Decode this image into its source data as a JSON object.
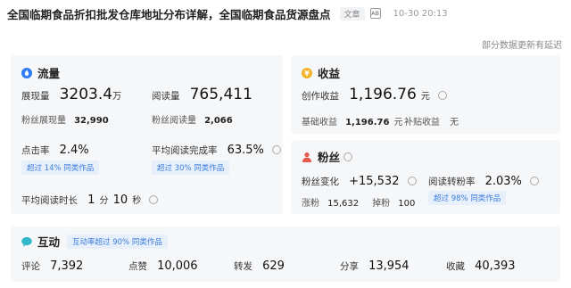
{
  "header": {
    "title": "全国临期食品折扣批发仓库地址分布详解，全国临期食品货源盘点",
    "tag": "文章",
    "ai_icon_text": "AB",
    "date": "10-30 20:13"
  },
  "update_note": "部分数据更新有延迟",
  "flow": {
    "title": "流量",
    "views_label": "展现量",
    "views_value": "3203.4",
    "views_unit": "万",
    "reads_label": "阅读量",
    "reads_value": "765,411",
    "fan_views_label": "粉丝展现量",
    "fan_views_value": "32,990",
    "fan_reads_label": "粉丝阅读量",
    "fan_reads_value": "2,066",
    "ctr_label": "点击率",
    "ctr_value": "2.4%",
    "ctr_badge": "超过 14% 同类作品",
    "completion_label": "平均阅读完成率",
    "completion_value": "63.5%",
    "completion_badge": "超过 30% 同类作品",
    "avg_time_label": "平均阅读时长",
    "avg_time_min": "1",
    "avg_time_min_unit": "分",
    "avg_time_sec": "10",
    "avg_time_sec_unit": "秒"
  },
  "income": {
    "title": "收益",
    "creation_label": "创作收益",
    "creation_value": "1,196.76",
    "creation_unit": "元",
    "base_label": "基础收益",
    "base_value": "1,196.76",
    "base_unit": "元",
    "subsidy_label": "补贴收益",
    "subsidy_value": "无"
  },
  "fans": {
    "title": "粉丝",
    "change_label": "粉丝变化",
    "change_value": "+15,532",
    "conv_label": "阅读转粉率",
    "conv_value": "2.03%",
    "gain_label": "涨粉",
    "gain_value": "15,632",
    "loss_label": "掉粉",
    "loss_value": "100",
    "conv_badge": "超过 98% 同类作品"
  },
  "interact": {
    "title": "互动",
    "badge": "互动率超过 90% 同类作品",
    "items": [
      {
        "label": "评论",
        "value": "7,392"
      },
      {
        "label": "点赞",
        "value": "10,006"
      },
      {
        "label": "转发",
        "value": "629"
      },
      {
        "label": "分享",
        "value": "13,954"
      },
      {
        "label": "收藏",
        "value": "40,393"
      }
    ]
  },
  "colors": {
    "flow_icon": "#2f7cf6",
    "income_icon": "#f0b429",
    "fans_icon": "#e8584f",
    "interact_icon": "#33b8c8",
    "badge_text": "#3b7ddd",
    "badge_bg": "#e7effb"
  }
}
